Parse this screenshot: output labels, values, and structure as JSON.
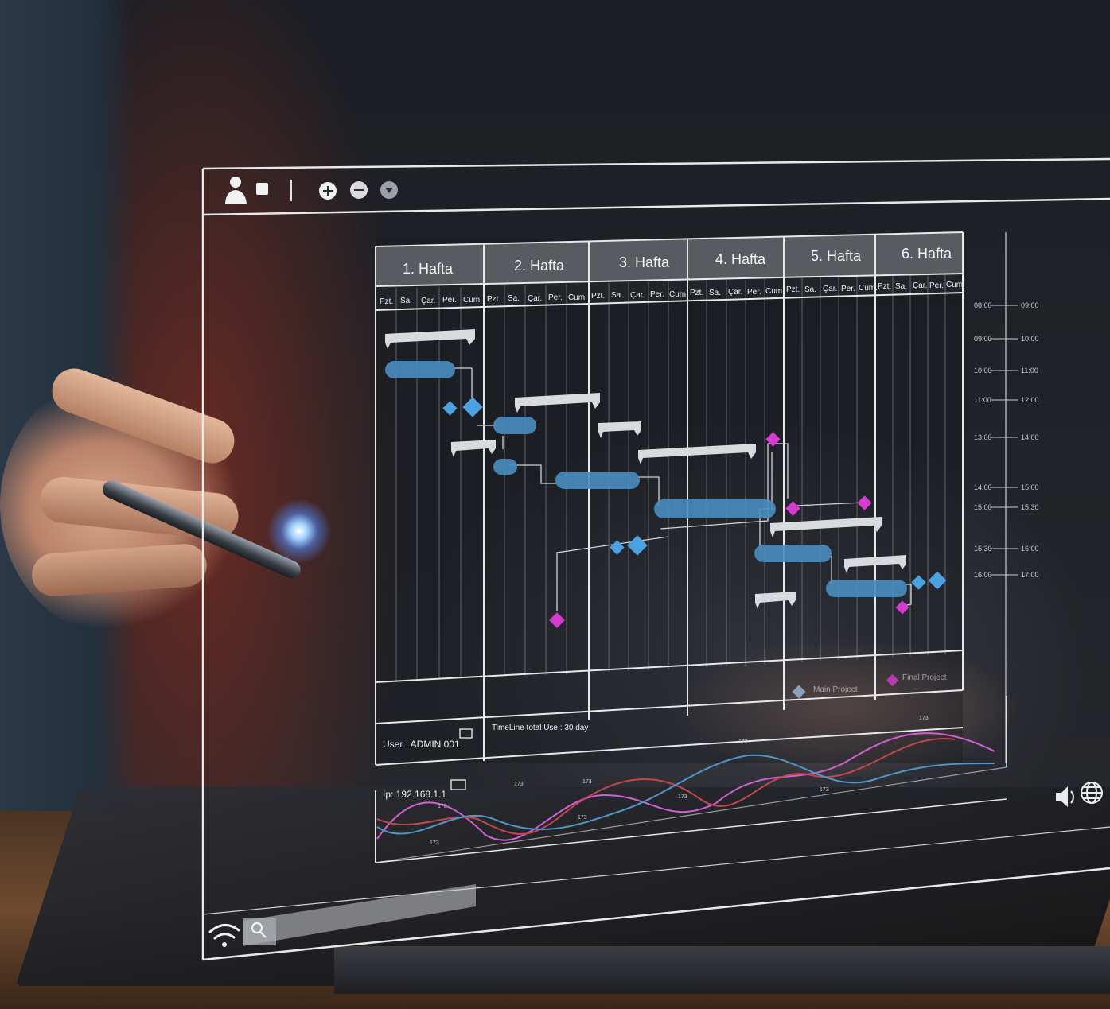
{
  "weeks": [
    "1. Hafta",
    "2. Hafta",
    "3. Hafta",
    "4. Hafta",
    "5. Hafta",
    "6. Hafta"
  ],
  "days": [
    "Pzt.",
    "Sa.",
    "Çar.",
    "Per.",
    "Cum."
  ],
  "footer": {
    "user": "User : ADMIN 001",
    "timeline": "TimeLine total Use : 30 day",
    "ip": "Ip: 192.168.1.1"
  },
  "legend": {
    "main": "Main Project",
    "final": "Final Project"
  },
  "time_scale": {
    "left": [
      "08:00",
      "09:00",
      "10:00",
      "11:00",
      "13:00",
      "14:00",
      "15:00",
      "15:30",
      "16:00"
    ],
    "right": [
      "09:00",
      "10:00",
      "11:00",
      "12:00",
      "14:00",
      "15:00",
      "15:30",
      "16:00",
      "17:00"
    ]
  },
  "wave_ticks": [
    "173",
    "173",
    "173",
    "173",
    "173",
    "173",
    "173",
    "173",
    "173"
  ],
  "icons": {
    "toolbar": [
      "user-icon",
      "square-icon",
      "plus-icon",
      "minus-icon",
      "dropdown-icon"
    ],
    "bottom": [
      "wifi-icon",
      "search-icon",
      "speaker-icon",
      "globe-icon"
    ]
  },
  "colors": {
    "bar_blue": "#4a8dbf",
    "summary_grey": "#d8dadd",
    "milestone_blue": "#4aa3e0",
    "milestone_magenta": "#d63bd0",
    "wave_pink": "#d060d0",
    "wave_red": "#c04850",
    "wave_blue": "#4f97c8"
  }
}
